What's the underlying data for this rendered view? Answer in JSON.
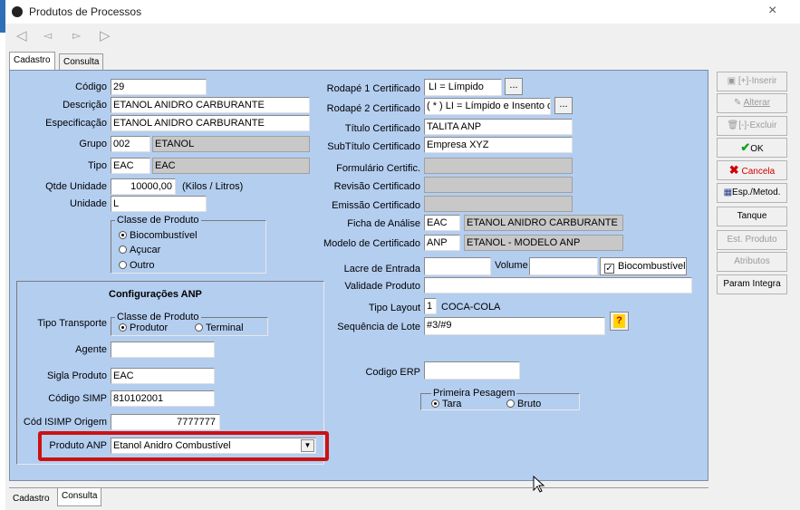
{
  "window": {
    "title": "Produtos de Processos",
    "close": "×"
  },
  "toolbar": {
    "icons": [
      "first-icon",
      "prev-icon",
      "next-icon",
      "last-icon"
    ]
  },
  "tabs_top": {
    "cadastro": "Cadastro",
    "consulta": "Consulta"
  },
  "tabs_bottom": {
    "cadastro": "Cadastro",
    "consulta": "Consulta"
  },
  "left": {
    "codigo": {
      "label": "Código",
      "value": "29"
    },
    "descricao": {
      "label": "Descrição",
      "value": "ETANOL ANIDRO CARBURANTE"
    },
    "especificacao": {
      "label": "Especificação",
      "value": "ETANOL ANIDRO CARBURANTE"
    },
    "grupo": {
      "label": "Grupo",
      "code": "002",
      "name": "ETANOL"
    },
    "tipo": {
      "label": "Tipo",
      "code": "EAC",
      "name": "EAC"
    },
    "qtde": {
      "label": "Qtde Unidade",
      "value": "10000,00",
      "unit": "(Kilos / Litros)"
    },
    "unidade": {
      "label": "Unidade",
      "value": "L"
    },
    "classe": {
      "legend": "Classe de Produto",
      "options": [
        "Biocombustível",
        "Açucar",
        "Outro"
      ],
      "selected": 0
    }
  },
  "anp": {
    "title": "Configurações ANP",
    "tipo_transporte": {
      "label": "Tipo Transporte",
      "legend": "Classe de Produto",
      "options": [
        "Produtor",
        "Terminal"
      ],
      "selected": 0
    },
    "agente": {
      "label": "Agente",
      "value": ""
    },
    "sigla": {
      "label": "Sigla Produto",
      "value": "EAC"
    },
    "simp": {
      "label": "Código SIMP",
      "value": "810102001"
    },
    "isimp": {
      "label": "Cód ISIMP Origem",
      "value": "7777777"
    },
    "produto": {
      "label": "Produto ANP",
      "value": "Etanol Anidro Combustível"
    }
  },
  "right": {
    "rodape1": {
      "label": "Rodapé 1 Certificado",
      "value": "LI = Límpido",
      "btn": "..."
    },
    "rodape2": {
      "label": "Rodapé 2 Certificado",
      "value": "( * ) LI = Límpido e Insento de",
      "btn": "..."
    },
    "titulo": {
      "label": "Título Certificado",
      "value": "TALITA ANP"
    },
    "subtitulo": {
      "label": "SubTítulo Certificado",
      "value": "Empresa XYZ"
    },
    "formulario": {
      "label": "Formulário Certific."
    },
    "revisao": {
      "label": "Revisão Certificado"
    },
    "emissao": {
      "label": "Emissão Certificado"
    },
    "ficha": {
      "label": "Ficha de Análise",
      "code": "EAC",
      "name": "ETANOL ANIDRO CARBURANTE"
    },
    "modelo": {
      "label": "Modelo de Certificado",
      "code": "ANP",
      "name": "ETANOL - MODELO ANP"
    },
    "lacre": {
      "label": "Lacre de Entrada",
      "value": ""
    },
    "volume": {
      "label": "Volume",
      "value": ""
    },
    "biocomb": {
      "label": "Biocombustível",
      "checked": true
    },
    "validade": {
      "label": "Validade Produto",
      "value": ""
    },
    "tipo_layout": {
      "label": "Tipo Layout",
      "code": "1",
      "name": "COCA-COLA"
    },
    "sequencia": {
      "label": "Sequência de Lote",
      "value": "#3/#9",
      "btn": "?"
    },
    "erp": {
      "label": "Codigo ERP",
      "value": ""
    },
    "pesagem": {
      "legend": "Primeira Pesagem",
      "options": [
        "Tara",
        "Bruto"
      ],
      "selected": 0
    }
  },
  "side_buttons": [
    {
      "label": "[+]-Inserir",
      "icon": "insert-icon",
      "enabled": false
    },
    {
      "label": "Alterar",
      "icon": "edit-icon",
      "enabled": false
    },
    {
      "label": "[-]-Excluir",
      "icon": "trash-icon",
      "enabled": false
    },
    {
      "label": "OK",
      "icon": "check-icon",
      "enabled": true,
      "color": "#1a9e1a"
    },
    {
      "label": "Cancela",
      "icon": "x-icon",
      "enabled": true,
      "color": "#d00000"
    },
    {
      "label": "Esp./Metod.",
      "icon": "grid-icon",
      "enabled": true
    },
    {
      "label": "Tanque",
      "enabled": true
    },
    {
      "label": "Est. Produto",
      "enabled": false
    },
    {
      "label": "Atributos",
      "enabled": false
    },
    {
      "label": "Param Integra",
      "enabled": true
    }
  ],
  "colors": {
    "panel": "#b4cef0",
    "highlight": "#cc1111",
    "window_bg": "#f0f0f0"
  }
}
